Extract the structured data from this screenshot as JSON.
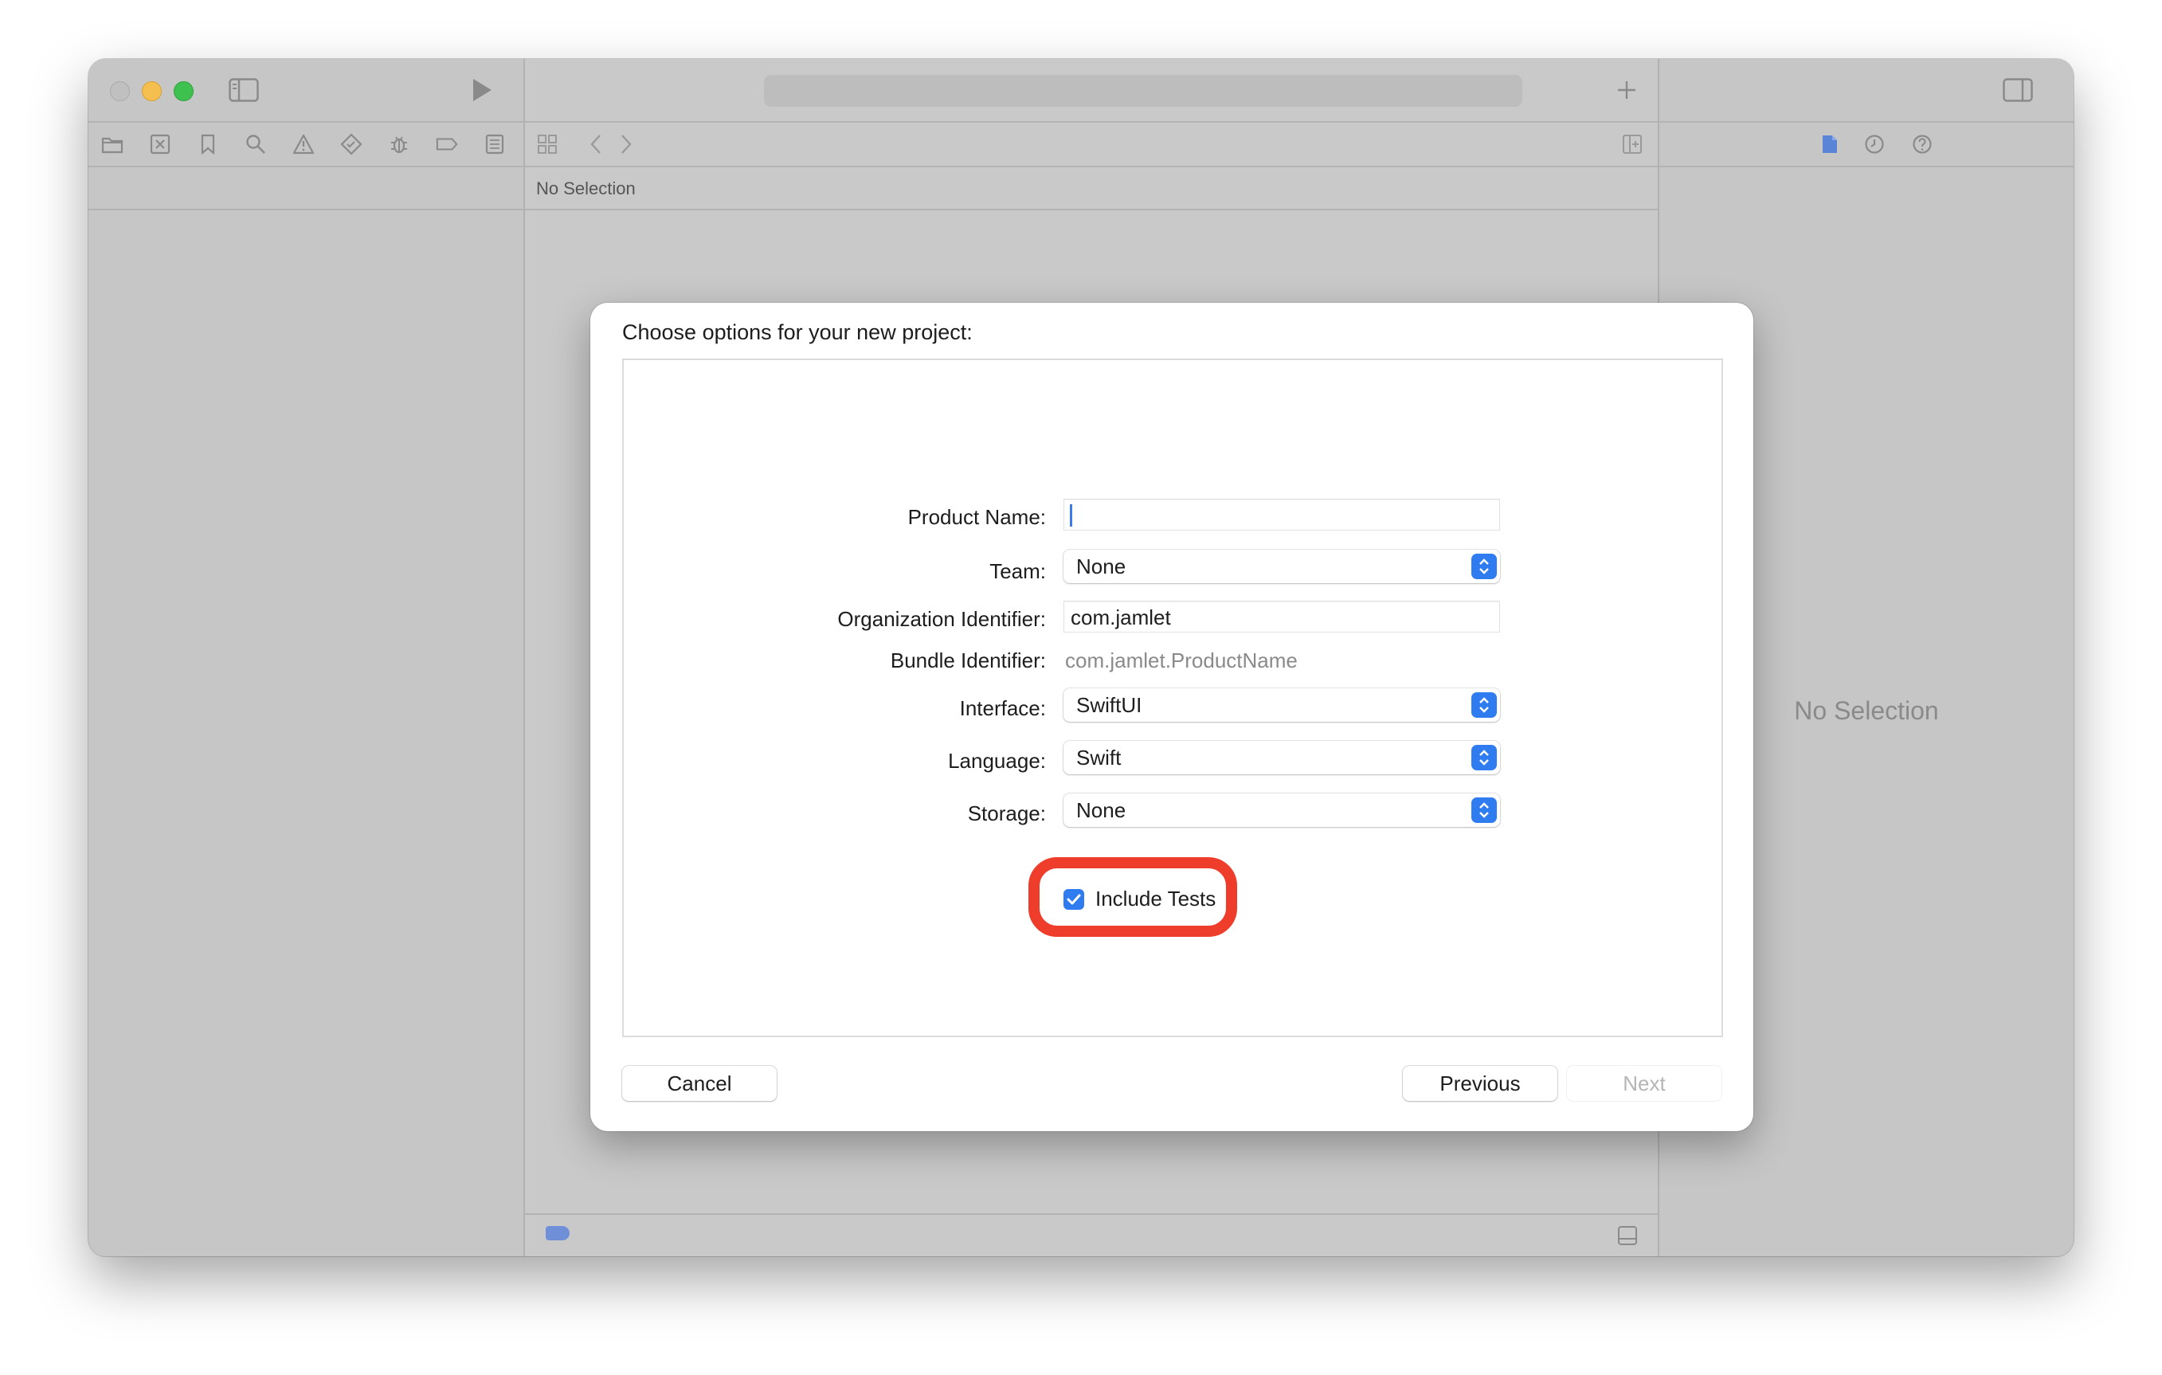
{
  "window": {
    "jump_bar_text": "No Selection",
    "inspector_empty_text": "No Selection"
  },
  "sheet": {
    "title": "Choose options for your new project:",
    "fields": {
      "product_name": {
        "label": "Product Name:",
        "value": ""
      },
      "team": {
        "label": "Team:",
        "value": "None"
      },
      "organization_identifier": {
        "label": "Organization Identifier:",
        "value": "com.jamlet"
      },
      "bundle_identifier": {
        "label": "Bundle Identifier:",
        "value": "com.jamlet.ProductName"
      },
      "interface": {
        "label": "Interface:",
        "value": "SwiftUI"
      },
      "language": {
        "label": "Language:",
        "value": "Swift"
      },
      "storage": {
        "label": "Storage:",
        "value": "None"
      }
    },
    "include_tests": {
      "label": "Include Tests",
      "checked": true
    },
    "buttons": {
      "cancel": "Cancel",
      "previous": "Previous",
      "next": "Next"
    }
  },
  "colors": {
    "accent": "#2f7cf0",
    "highlight": "#ee3d2a"
  },
  "icons": {
    "navigator": [
      "folder-icon",
      "source-control-icon",
      "bookmark-icon",
      "search-icon",
      "warning-icon",
      "test-icon",
      "debug-icon",
      "breakpoint-icon",
      "report-icon"
    ],
    "inspector": [
      "file-icon",
      "history-icon",
      "help-icon"
    ]
  }
}
